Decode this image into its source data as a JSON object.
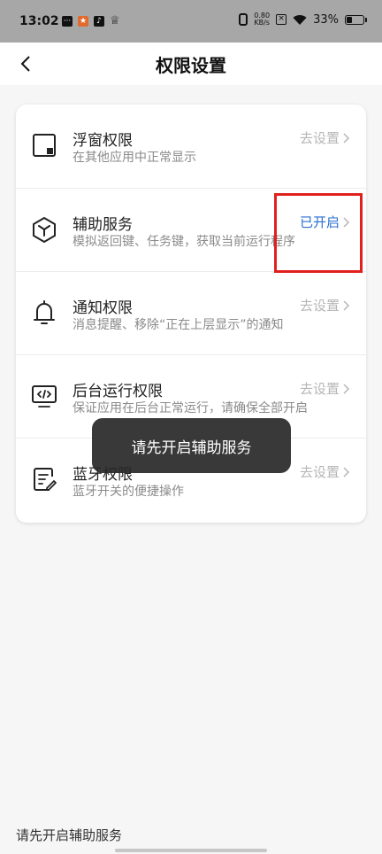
{
  "status_bar": {
    "time": "13:02",
    "network_speed": "0.80",
    "network_speed_unit": "KB/s",
    "battery_percent": "33%",
    "battery_level": 0.33
  },
  "header": {
    "title": "权限设置"
  },
  "permissions": [
    {
      "title": "浮窗权限",
      "desc": "在其他应用中正常显示",
      "action": "去设置",
      "enabled": false,
      "icon": "floating-window-icon"
    },
    {
      "title": "辅助服务",
      "desc": "模拟返回键、任务键，获取当前运行程序",
      "action": "已开启",
      "enabled": true,
      "icon": "cube-icon"
    },
    {
      "title": "通知权限",
      "desc": "消息提醒、移除“正在上层显示”的通知",
      "action": "去设置",
      "enabled": false,
      "icon": "bell-icon"
    },
    {
      "title": "后台运行权限",
      "desc": "保证应用在后台正常运行，请确保全部开启",
      "action": "去设置",
      "enabled": false,
      "icon": "monitor-code-icon"
    },
    {
      "title": "蓝牙权限",
      "desc": "蓝牙开关的便捷操作",
      "action": "去设置",
      "enabled": false,
      "icon": "edit-document-icon"
    }
  ],
  "toast": "请先开启辅助服务",
  "bottom_text": "请先开启辅助服务",
  "colors": {
    "enabled_action": "#2a6ed1",
    "highlight": "#e0201d",
    "disabled_action": "#b6b6b6"
  }
}
